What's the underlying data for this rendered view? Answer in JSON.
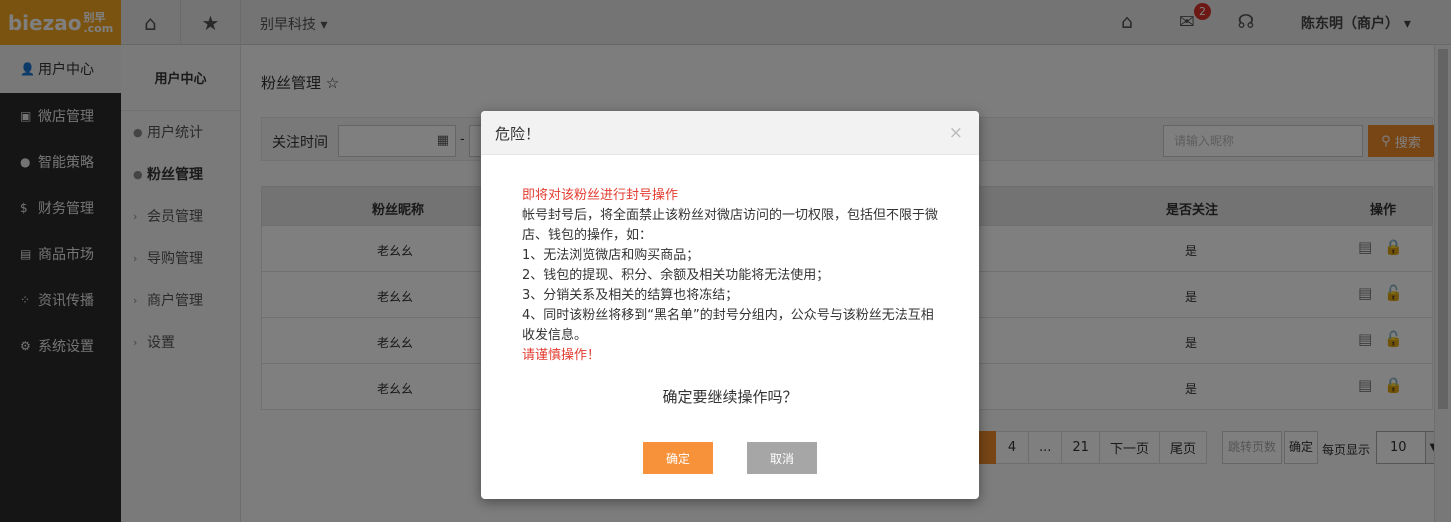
{
  "topbar": {
    "logo_text": "biezao",
    "logo_sub_cn": "别早",
    "logo_sub_en": ".com",
    "home_icon": "home-icon",
    "star_icon": "star-icon",
    "company": "别早科技",
    "mail_badge": "2",
    "username": "陈东明（商户）"
  },
  "leftnav": [
    {
      "label": "用户中心",
      "icon": "user-icon"
    },
    {
      "label": "微店管理",
      "icon": "shop-icon"
    },
    {
      "label": "智能策略",
      "icon": "strategy-icon"
    },
    {
      "label": "财务管理",
      "icon": "money-icon"
    },
    {
      "label": "商品市场",
      "icon": "market-icon"
    },
    {
      "label": "资讯传播",
      "icon": "news-icon"
    },
    {
      "label": "系统设置",
      "icon": "gear-icon"
    }
  ],
  "subnav": {
    "head": "用户中心",
    "items": [
      "用户统计",
      "粉丝管理",
      "会员管理",
      "导购管理",
      "商户管理",
      "设置"
    ]
  },
  "main": {
    "title": "粉丝管理",
    "filter_label": "关注时间",
    "search_placeholder": "请输入昵称",
    "search_button": "搜索",
    "columns": {
      "nick": "粉丝昵称",
      "follow": "是否关注",
      "ops": "操作"
    },
    "rows": [
      {
        "nick": "老幺幺",
        "follow": "是"
      },
      {
        "nick": "老幺幺",
        "follow": "是"
      },
      {
        "nick": "老幺幺",
        "follow": "是"
      },
      {
        "nick": "老幺幺",
        "follow": "是"
      }
    ],
    "pager": {
      "pages": [
        "4",
        "...",
        "21",
        "下一页",
        "尾页"
      ],
      "jump_placeholder": "跳转页数",
      "jump_ok": "确定",
      "per_page_label": "每页显示",
      "per_page_value": "10"
    }
  },
  "modal": {
    "title": "危险！",
    "close": "×",
    "warn_head": "即将对该粉丝进行封号操作",
    "lines": [
      "帐号封号后，将全面禁止该粉丝对微店访问的一切权限，包括但不限于微店、钱包的操作，如：",
      "1、无法浏览微店和购买商品；",
      "2、钱包的提现、积分、余额及相关功能将无法使用；",
      "3、分销关系及相关的结算也将冻结；",
      "4、同时该粉丝将移到“黑名单”的封号分组内，公众号与该粉丝无法互相收发信息。"
    ],
    "warn_tail": "请谨慎操作！",
    "question": "确定要继续操作吗？",
    "ok_label": "确定",
    "cancel_label": "取消"
  }
}
